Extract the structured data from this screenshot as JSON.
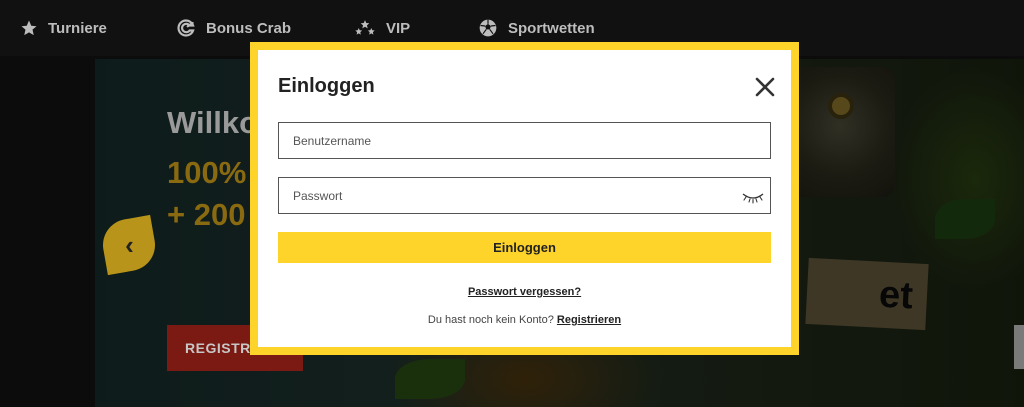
{
  "nav": {
    "items": [
      {
        "label": "Turniere",
        "icon": "star-icon"
      },
      {
        "label": "Bonus Crab",
        "icon": "crab-claw-icon"
      },
      {
        "label": "VIP",
        "icon": "stars-icon"
      },
      {
        "label": "Sportwetten",
        "icon": "soccer-ball-icon"
      }
    ]
  },
  "hero": {
    "title": "Willko",
    "line1": "100%",
    "line2": "+ 200",
    "cta_label": "REGISTRI",
    "badge_text": "et",
    "prev_icon": "‹"
  },
  "login": {
    "title": "Einloggen",
    "username_placeholder": "Benutzername",
    "password_placeholder": "Passwort",
    "submit_label": "Einloggen",
    "forgot_label": "Passwort vergessen?",
    "signup_prompt": "Du hast noch kein Konto?",
    "signup_link": "Registrieren"
  },
  "colors": {
    "accent": "#ffd42a",
    "background": "#0c0c0c",
    "cta": "#7a1a12"
  }
}
